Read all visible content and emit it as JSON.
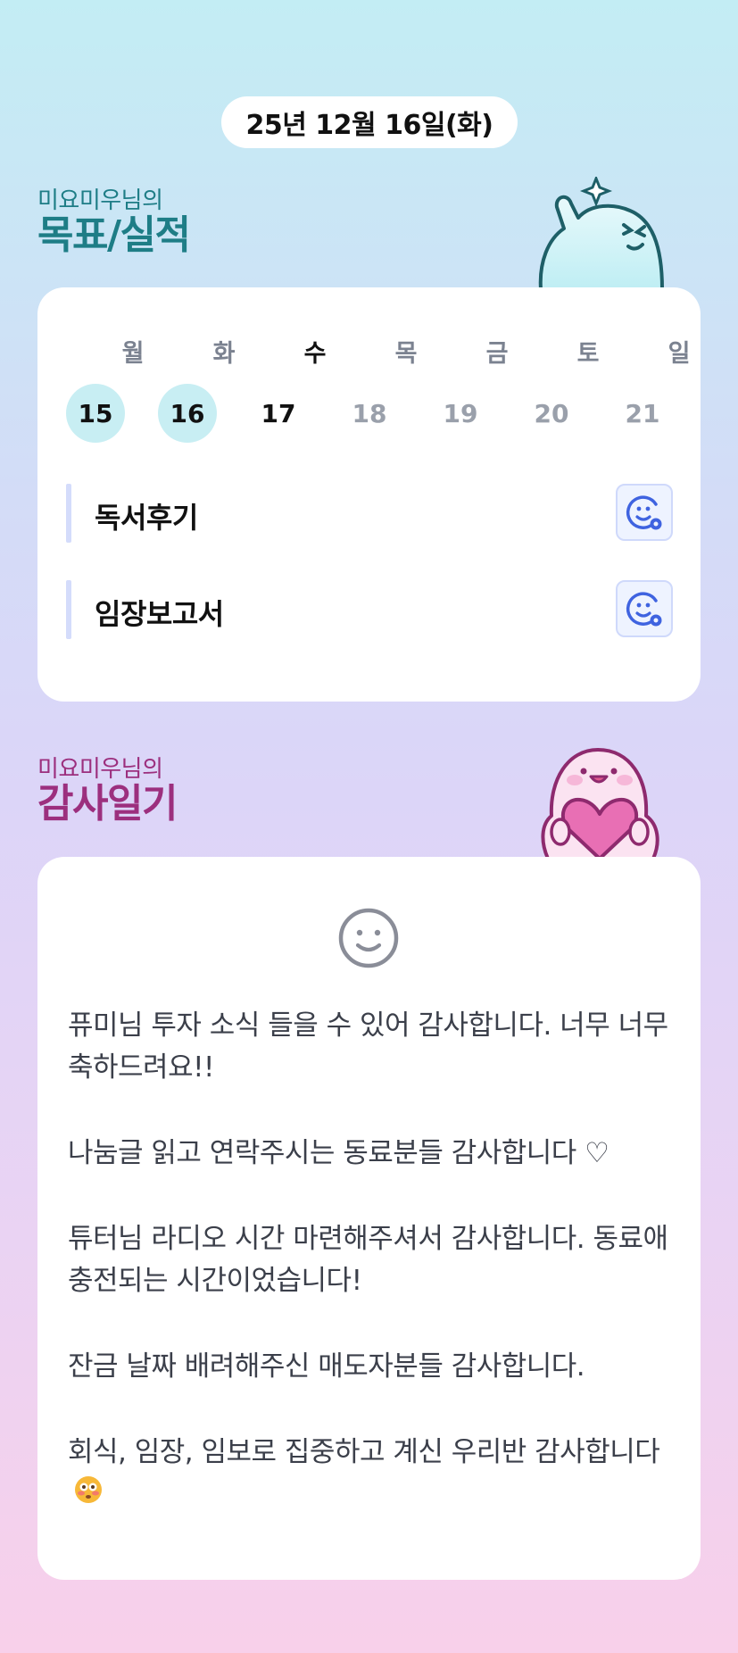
{
  "date": "25년 12월 16일(화)",
  "goals": {
    "subtitle": "미요미우님의",
    "title": "목표/실적",
    "week": [
      {
        "day": "월",
        "date": "15",
        "state": "done"
      },
      {
        "day": "화",
        "date": "16",
        "state": "done"
      },
      {
        "day": "수",
        "date": "17",
        "state": "today"
      },
      {
        "day": "목",
        "date": "18",
        "state": "future"
      },
      {
        "day": "금",
        "date": "19",
        "state": "future"
      },
      {
        "day": "토",
        "date": "20",
        "state": "future"
      },
      {
        "day": "일",
        "date": "21",
        "state": "future"
      }
    ],
    "items": [
      {
        "label": "독서후기",
        "icon": "smiley-add-icon"
      },
      {
        "label": "임장보고서",
        "icon": "smiley-add-icon"
      }
    ]
  },
  "gratitude": {
    "subtitle": "미요미우님의",
    "title": "감사일기",
    "mood_icon": "smiley-icon",
    "entries": [
      "퓨미님 투자 소식 들을 수 있어 감사합니다. 너무 너무 축하드려요!!",
      "나눔글 읽고 연락주시는 동료분들 감사합니다 ♡",
      "튜터님 라디오 시간 마련해주셔서 감사합니다. 동료애 충전되는 시간이었습니다!",
      "잔금 날짜 배려해주신 매도자분들 감사합니다.",
      "회식, 임장, 임보로 집중하고 계신 우리반 감사합니다"
    ],
    "last_entry_emoji": "flushed-face-emoji"
  },
  "colors": {
    "goals_title": "#1e7d86",
    "gratitude_title": "#9c2f7e",
    "active_day": "#c8eef3",
    "accent_blue": "#3f63e0"
  }
}
